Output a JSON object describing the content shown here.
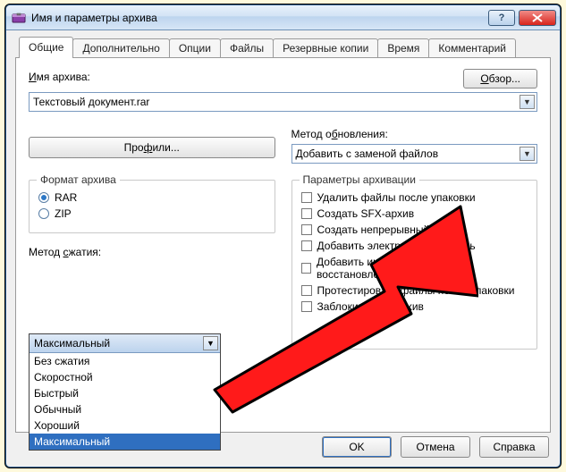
{
  "window": {
    "title": "Имя и параметры архива"
  },
  "tabs": {
    "general": "Общие",
    "advanced": "Дополнительно",
    "options": "Опции",
    "files": "Файлы",
    "backup": "Резервные копии",
    "time": "Время",
    "comment": "Комментарий"
  },
  "archive": {
    "name_label": "Имя архива:",
    "name_underline": "И",
    "value": "Текстовый документ.rar",
    "browse": "Обзор...",
    "browse_underline": "О"
  },
  "update": {
    "label": "Метод обновления:",
    "underline": "б",
    "value": "Добавить с заменой файлов"
  },
  "profiles": {
    "label": "Профили...",
    "underline": "ф"
  },
  "format": {
    "legend": "Формат архива",
    "rar": "RAR",
    "zip": "ZIP",
    "selected": "RAR"
  },
  "compression": {
    "label": "Метод сжатия:",
    "underline": "с",
    "selected": "Максимальный",
    "options": [
      "Без сжатия",
      "Скоростной",
      "Быстрый",
      "Обычный",
      "Хороший",
      "Максимальный"
    ]
  },
  "archiving_params": {
    "legend": "Параметры архивации",
    "items": [
      "Удалить файлы после упаковки",
      "Создать SFX-архив",
      "Создать непрерывный архив",
      "Добавить электронную подпись",
      "Добавить информацию для восстановления",
      "Протестировать файлы после упаковки",
      "Заблокировать архив"
    ]
  },
  "buttons": {
    "ok": "OK",
    "cancel": "Отмена",
    "help": "Справка"
  }
}
